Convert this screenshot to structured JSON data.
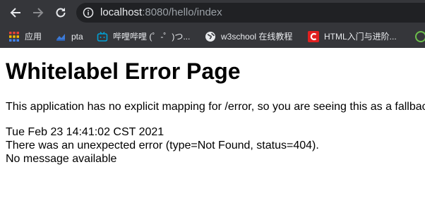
{
  "browser": {
    "url_host": "localhost",
    "url_rest": ":8080/hello/index",
    "bookmarks": [
      {
        "label": "应用",
        "icon": "apps-grid-icon"
      },
      {
        "label": "pta",
        "icon": "pta-favicon-icon"
      },
      {
        "label": "哔哩哔哩 (゜-゜)つ...",
        "icon": "bilibili-icon"
      },
      {
        "label": "w3school 在线教程",
        "icon": "globe-icon"
      },
      {
        "label": "HTML入门与进阶...",
        "icon": "c-logo-icon"
      }
    ],
    "colors": {
      "chrome": "#35363a",
      "omnibox": "#202124",
      "icon": "#e8eaed"
    }
  },
  "page": {
    "title": "Whitelabel Error Page",
    "description": "This application has no explicit mapping for /error, so you are seeing this as a fallback.",
    "timestamp": "Tue Feb 23 14:41:02 CST 2021",
    "error_line": "There was an unexpected error (type=Not Found, status=404).",
    "message": "No message available"
  }
}
